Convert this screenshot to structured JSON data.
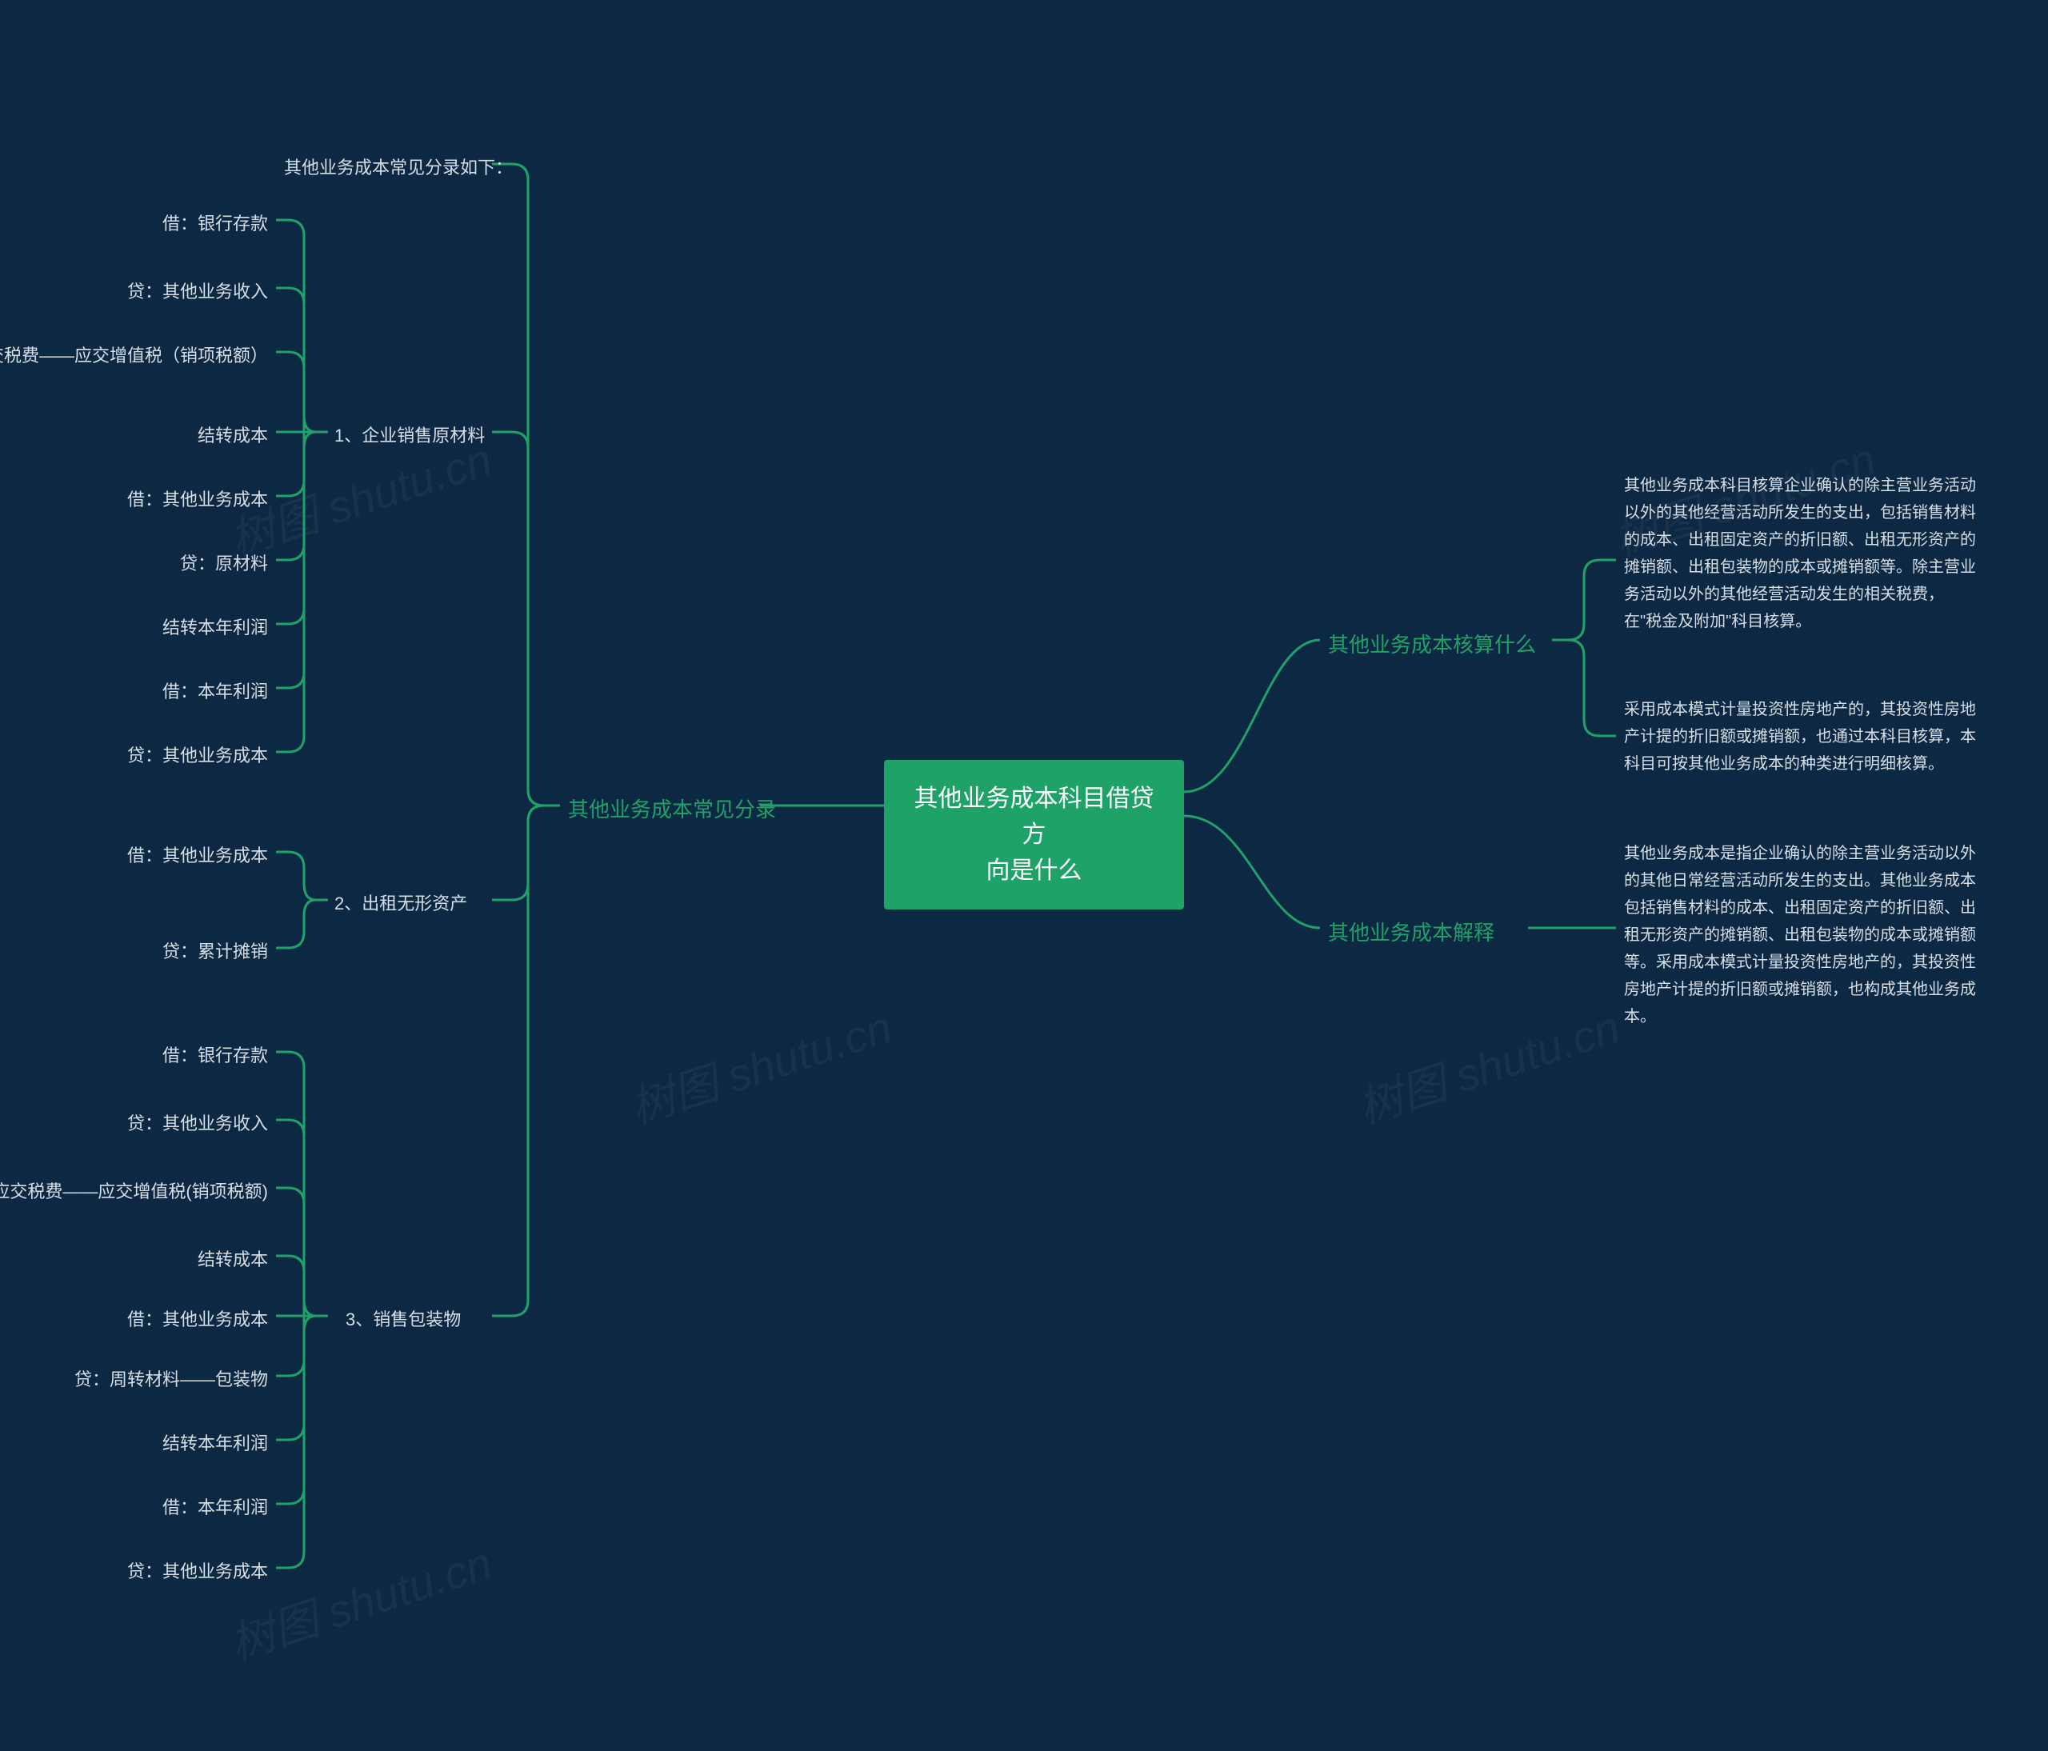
{
  "root": {
    "line1": "其他业务成本科目借贷方",
    "line2": "向是什么"
  },
  "left": {
    "branch": "其他业务成本常见分录",
    "items": [
      {
        "label": "其他业务成本常见分录如下：",
        "children": []
      },
      {
        "label": "1、企业销售原材料",
        "children": [
          "借：银行存款",
          "贷：其他业务收入",
          "应交税费——应交增值税（销项税额）",
          "结转成本",
          "借：其他业务成本",
          "贷：原材料",
          "结转本年利润",
          "借：本年利润",
          "贷：其他业务成本"
        ]
      },
      {
        "label": "2、出租无形资产",
        "children": [
          "借：其他业务成本",
          "贷：累计摊销"
        ]
      },
      {
        "label": "3、销售包装物",
        "children": [
          "借：银行存款",
          "贷：其他业务收入",
          "应交税费——应交增值税(销项税额)",
          "结转成本",
          "借：其他业务成本",
          "贷：周转材料——包装物",
          "结转本年利润",
          "借：本年利润",
          "贷：其他业务成本"
        ]
      }
    ]
  },
  "right": {
    "branch1": {
      "label": "其他业务成本核算什么",
      "desc1": "其他业务成本科目核算企业确认的除主营业务活动以外的其他经营活动所发生的支出，包括销售材料的成本、出租固定资产的折旧额、出租无形资产的摊销额、出租包装物的成本或摊销额等。除主营业务活动以外的其他经营活动发生的相关税费，在\"税金及附加\"科目核算。",
      "desc2": "采用成本模式计量投资性房地产的，其投资性房地产计提的折旧额或摊销额，也通过本科目核算，本科目可按其他业务成本的种类进行明细核算。"
    },
    "branch2": {
      "label": "其他业务成本解释",
      "desc": "其他业务成本是指企业确认的除主营业务活动以外的其他日常经营活动所发生的支出。其他业务成本包括销售材料的成本、出租固定资产的折旧额、出租无形资产的摊销额、出租包装物的成本或摊销额等。采用成本模式计量投资性房地产的，其投资性房地产计提的折旧额或摊销额，也构成其他业务成本。"
    }
  },
  "watermark": "树图 shutu.cn"
}
